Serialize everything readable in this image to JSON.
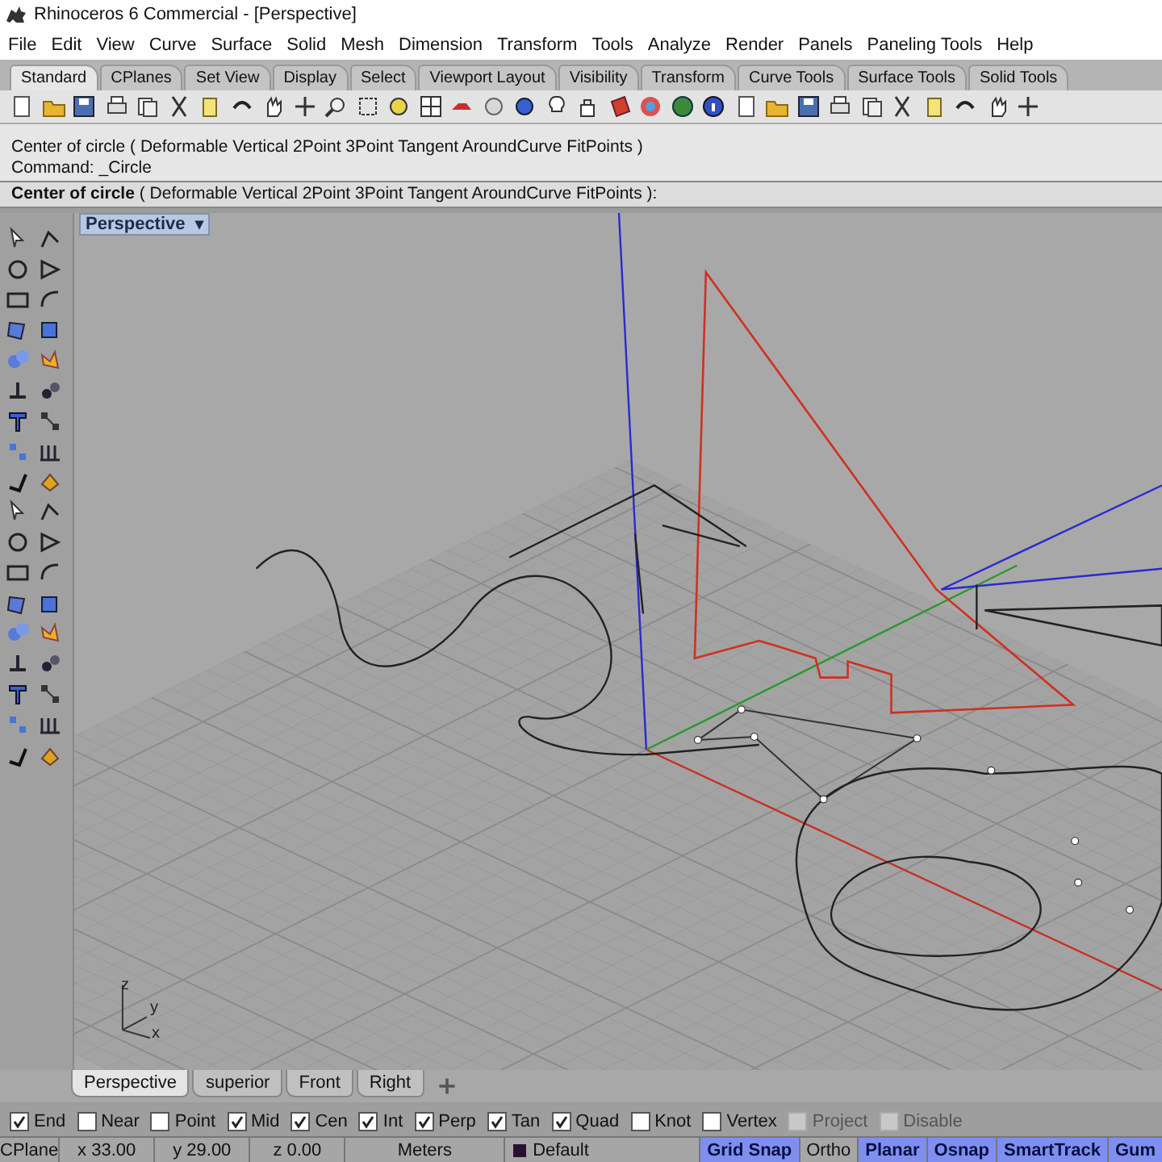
{
  "window": {
    "title": "Rhinoceros 6 Commercial - [Perspective]"
  },
  "menu": [
    "File",
    "Edit",
    "View",
    "Curve",
    "Surface",
    "Solid",
    "Mesh",
    "Dimension",
    "Transform",
    "Tools",
    "Analyze",
    "Render",
    "Panels",
    "Paneling Tools",
    "Help"
  ],
  "toolbar_tabs": [
    {
      "label": "Standard",
      "selected": true
    },
    {
      "label": "CPlanes",
      "selected": false
    },
    {
      "label": "Set View",
      "selected": false
    },
    {
      "label": "Display",
      "selected": false
    },
    {
      "label": "Select",
      "selected": false
    },
    {
      "label": "Viewport Layout",
      "selected": false
    },
    {
      "label": "Visibility",
      "selected": false
    },
    {
      "label": "Transform",
      "selected": false
    },
    {
      "label": "Curve Tools",
      "selected": false
    },
    {
      "label": "Surface Tools",
      "selected": false
    },
    {
      "label": "Solid Tools",
      "selected": false
    }
  ],
  "command_history": [
    "Center of circle ( Deformable  Vertical  2Point  3Point  Tangent  AroundCurve  FitPoints )",
    "Command: _Circle"
  ],
  "command_prompt": {
    "label": "Center of circle",
    "options": "( Deformable  Vertical  2Point  3Point  Tangent  AroundCurve  FitPoints ):"
  },
  "viewport": {
    "title": "Perspective",
    "dropdown": "▾",
    "axis_labels": [
      "z",
      "y",
      "x"
    ]
  },
  "viewport_tabs": [
    {
      "label": "Perspective",
      "selected": true
    },
    {
      "label": "superior",
      "selected": false
    },
    {
      "label": "Front",
      "selected": false
    },
    {
      "label": "Right",
      "selected": false
    }
  ],
  "osnaps": [
    {
      "label": "End",
      "checked": true,
      "disabled": false
    },
    {
      "label": "Near",
      "checked": false,
      "disabled": false
    },
    {
      "label": "Point",
      "checked": false,
      "disabled": false
    },
    {
      "label": "Mid",
      "checked": true,
      "disabled": false
    },
    {
      "label": "Cen",
      "checked": true,
      "disabled": false
    },
    {
      "label": "Int",
      "checked": true,
      "disabled": false
    },
    {
      "label": "Perp",
      "checked": true,
      "disabled": false
    },
    {
      "label": "Tan",
      "checked": true,
      "disabled": false
    },
    {
      "label": "Quad",
      "checked": true,
      "disabled": false
    },
    {
      "label": "Knot",
      "checked": false,
      "disabled": false
    },
    {
      "label": "Vertex",
      "checked": false,
      "disabled": false
    },
    {
      "label": "Project",
      "checked": false,
      "disabled": true
    },
    {
      "label": "Disable",
      "checked": false,
      "disabled": true
    }
  ],
  "status_bar": {
    "cplane": "CPlane",
    "x": "x 33.00",
    "y": "y 29.00",
    "z": "z 0.00",
    "units": "Meters",
    "layer": {
      "name": "Default",
      "color": "#2a1030"
    },
    "toggles": [
      {
        "label": "Grid Snap",
        "selected": true
      },
      {
        "label": "Ortho",
        "selected": false
      },
      {
        "label": "Planar",
        "selected": true
      },
      {
        "label": "Osnap",
        "selected": true
      },
      {
        "label": "SmartTrack",
        "selected": true
      },
      {
        "label": "Gum",
        "selected": true
      }
    ]
  }
}
